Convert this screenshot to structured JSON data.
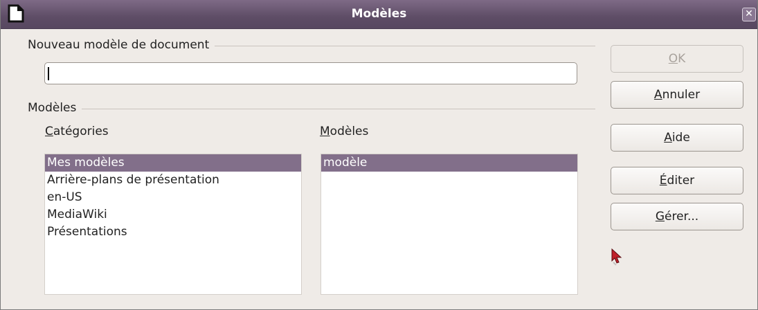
{
  "window": {
    "title": "Modèles",
    "close_glyph": "✕"
  },
  "new_template": {
    "section_label": "Nouveau modèle de document",
    "name_value": ""
  },
  "templates_section": {
    "section_label": "Modèles",
    "categories": {
      "label_mnemonic": "C",
      "label_rest": "atégories",
      "items": [
        {
          "label": "Mes modèles",
          "selected": true
        },
        {
          "label": "Arrière-plans de présentation",
          "selected": false
        },
        {
          "label": "en-US",
          "selected": false
        },
        {
          "label": "MediaWiki",
          "selected": false
        },
        {
          "label": "Présentations",
          "selected": false
        }
      ]
    },
    "templates": {
      "label_mnemonic": "M",
      "label_rest": "odèles",
      "items": [
        {
          "label": "modèle",
          "selected": true
        }
      ]
    }
  },
  "buttons": {
    "ok": {
      "mnemonic": "O",
      "rest": "K",
      "disabled": true
    },
    "cancel": {
      "mnemonic": "A",
      "rest": "nnuler"
    },
    "help": {
      "pre": "",
      "mnemonic": "A",
      "rest": "ide"
    },
    "edit": {
      "mnemonic": "É",
      "rest": "diter"
    },
    "manage": {
      "mnemonic": "G",
      "rest": "érer..."
    }
  },
  "colors": {
    "titlebar": "#5e4d66",
    "selection": "#826f8a",
    "background": "#efebe7"
  },
  "icons": {
    "app": "document-icon",
    "close": "close-icon",
    "pointer": "mouse-pointer-icon"
  }
}
